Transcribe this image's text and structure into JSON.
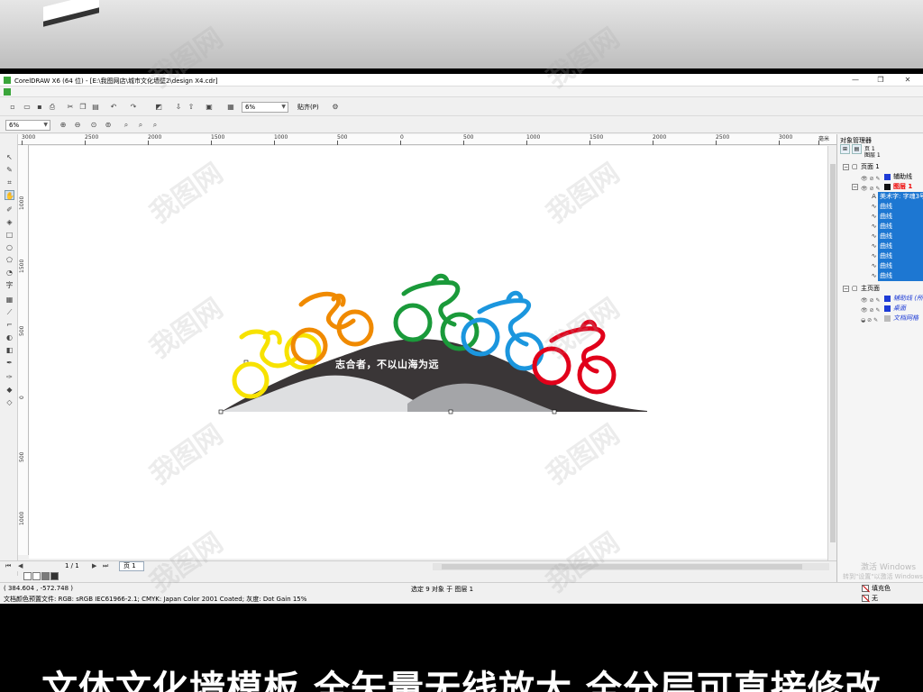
{
  "window": {
    "title": "CorelDRAW X6 (64 位) - [E:\\我图网店\\城市文化墙壁2\\design X4.cdr]",
    "controls": [
      "—",
      "❐",
      "✕"
    ]
  },
  "toolbar": {
    "zoom_value": "6%",
    "snap_label": "贴齐(P)",
    "zoom_field": "6%"
  },
  "rulers": {
    "horizontal": [
      "3000",
      "2500",
      "2000",
      "1500",
      "1000",
      "500",
      "0",
      "500",
      "1000",
      "1500",
      "2000",
      "2500",
      "3000"
    ],
    "vertical": [
      "1000",
      "1500",
      "500",
      "0",
      "500",
      "1000"
    ],
    "unit_h": "毫米",
    "unit_v": "毫米"
  },
  "artwork": {
    "slogan": "志合者，不以山海为远",
    "colors": {
      "yellow": "#f7e200",
      "orange": "#f08a00",
      "green": "#1a9a3a",
      "blue": "#1b96de",
      "red": "#e1001a",
      "dark_hill": "#3a3637",
      "light_hill": "#dedfe1",
      "mid_hill": "#a4a5a8"
    }
  },
  "page_nav": {
    "counter": "1 / 1",
    "tab_label": "页 1"
  },
  "status": {
    "coords": "( 384.604 , -572.748 )",
    "selection": "选定 9 对象 于 图层 1",
    "color_profile": "文档颜色预置文件: RGB: sRGB IEC61966-2.1; CMYK: Japan Color 2001 Coated; 灰度: Dot Gain 15%",
    "fill_label": "填充色",
    "outline_label": "无"
  },
  "object_manager": {
    "title": "对象管理器",
    "page_info_page": "页 1",
    "page_info_layer": "图层 1",
    "page1": "页面 1",
    "guides_layer": "辅助线",
    "layer1": "图层 1",
    "text_object": "美术字: 字魂3号",
    "curves": [
      "曲线",
      "曲线",
      "曲线",
      "曲线",
      "曲线",
      "曲线",
      "曲线",
      "曲线"
    ],
    "master_page": "主页面",
    "master_guides": "辅助线 (所",
    "desktop": "桌面",
    "doc_grid": "文档网格"
  },
  "os_watermark": {
    "line1": "激活 Windows",
    "line2": "转到\"设置\"以激活 Windows"
  },
  "caption": "文体文化墙模板  全矢量无线放大 全分层可直接修改",
  "watermark_text": "我图网"
}
